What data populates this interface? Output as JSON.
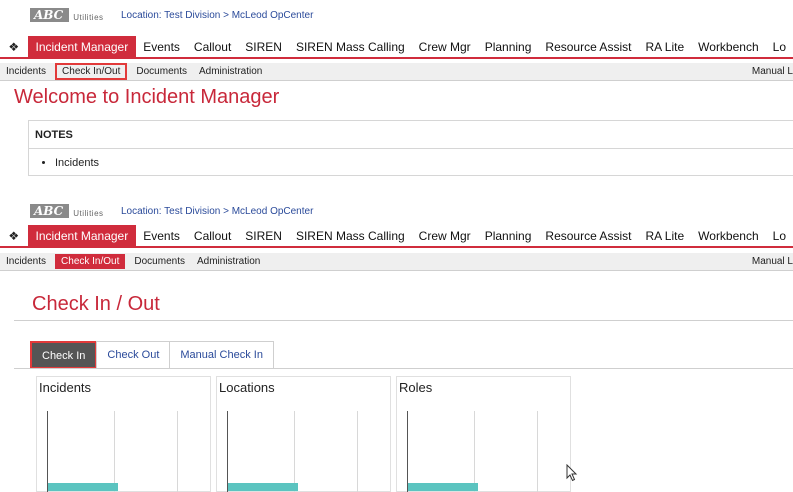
{
  "logo": {
    "brand": "ABC",
    "sub": "Utilities"
  },
  "location": "Location:  Test Division  > McLeod OpCenter",
  "nav": {
    "home_icon": "home-icon",
    "items": [
      "Incident Manager",
      "Events",
      "Callout",
      "SIREN",
      "SIREN Mass Calling",
      "Crew Mgr",
      "Planning",
      "Resource Assist",
      "RA Lite",
      "Workbench",
      "Lo"
    ]
  },
  "subnav": {
    "items": [
      "Incidents",
      "Check In/Out",
      "Documents",
      "Administration"
    ],
    "manual": "Manual L"
  },
  "welcome": {
    "title": "Welcome to Incident Manager",
    "notes_header": "NOTES",
    "notes_items": [
      "Incidents"
    ]
  },
  "checkin": {
    "title": "Check In / Out",
    "tabs": [
      "Check In",
      "Check Out",
      "Manual Check In"
    ],
    "panels": [
      {
        "title": "Incidents"
      },
      {
        "title": "Locations"
      },
      {
        "title": "Roles"
      }
    ]
  },
  "colors": {
    "accent": "#d02c3c",
    "bar": "#5bc4c0",
    "link": "#2a4a9a"
  }
}
